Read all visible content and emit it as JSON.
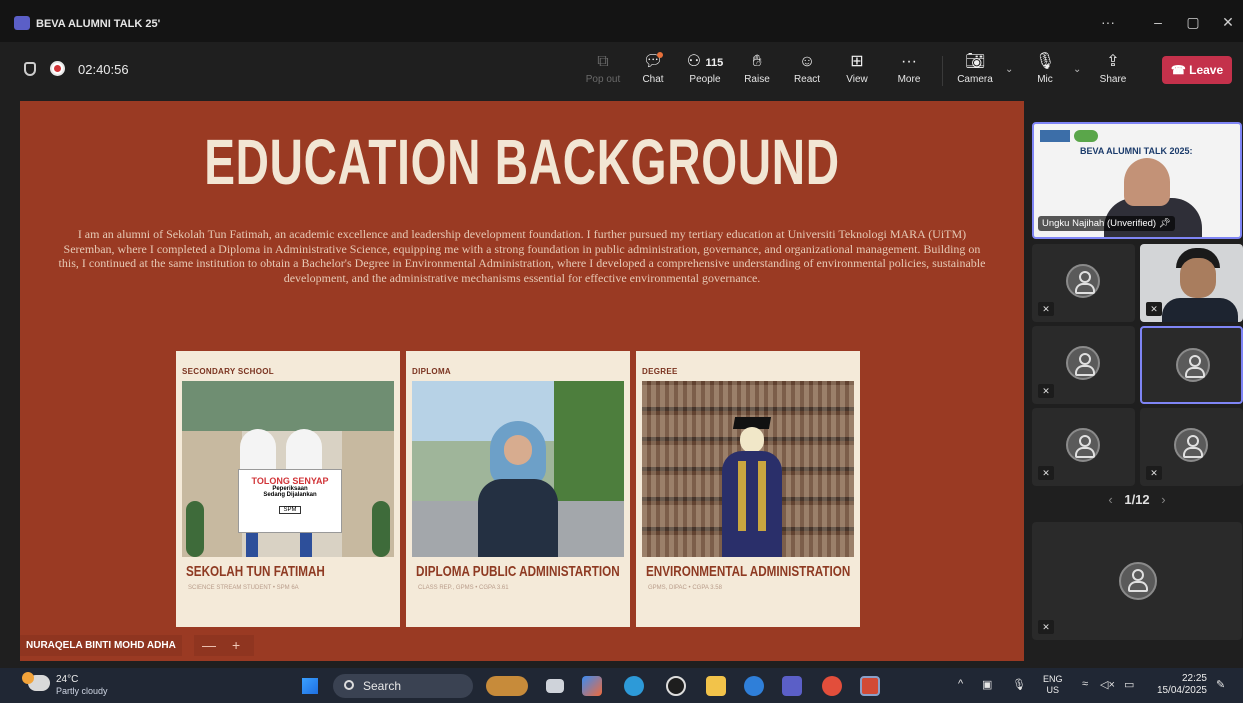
{
  "window": {
    "title": "BEVA ALUMNI TALK 25'",
    "more": "···",
    "minimize": "–",
    "maximize": "▢",
    "close": "✕"
  },
  "meeting": {
    "elapsed": "02:40:56",
    "toolbar": {
      "popout": "Pop out",
      "chat": "Chat",
      "people_count": "115",
      "people": "People",
      "raise": "Raise",
      "react": "React",
      "view": "View",
      "more": "More",
      "camera": "Camera",
      "mic": "Mic",
      "share": "Share",
      "leave": "Leave"
    }
  },
  "slide": {
    "title": "EDUCATION BACKGROUND",
    "body": "I am an alumni of Sekolah Tun Fatimah, an academic excellence and leadership development foundation. I further pursued my tertiary education at Universiti Teknologi MARA (UiTM) Seremban, where I completed a Diploma in Administrative Science, equipping me with a strong foundation in public administration, governance, and organizational management. Building on this, I continued at the same institution to obtain a Bachelor's Degree in Environmental Administration, where I developed a comprehensive understanding of environmental policies, sustainable development, and the administrative mechanisms essential for effective environmental governance.",
    "cards": [
      {
        "tag": "SECONDARY SCHOOL",
        "name": "SEKOLAH TUN FATIMAH",
        "sub": "SCIENCE STREAM STUDENT • SPM 6A",
        "sign1": "TOLONG SENYAP",
        "sign2": "Peperiksaan",
        "sign3": "Sedang Dijalankan",
        "sign4": "SPM"
      },
      {
        "tag": "DIPLOMA",
        "name": "DIPLOMA PUBLIC ADMINISTARTION",
        "sub": "CLASS REP., GPMS • CGPA 3.61"
      },
      {
        "tag": "DEGREE",
        "name": "ENVIRONMENTAL ADMINISTRATION",
        "sub": "GPMS, DIPAC • CGPA 3.58"
      }
    ]
  },
  "presenter_label": "NURAQELA BINTI MOHD ADHA",
  "zoom": {
    "minus": "—",
    "plus": "+"
  },
  "featured": {
    "banner": "BEVA ALUMNI TALK 2025:",
    "name": "Ungku Najihah (Unverified)"
  },
  "pager": {
    "prev": "‹",
    "page": "1/12",
    "next": "›"
  },
  "taskbar": {
    "temp": "24°C",
    "condition": "Partly cloudy",
    "search": "Search",
    "lang_top": "ENG",
    "lang_bottom": "US",
    "time": "22:25",
    "date": "15/04/2025"
  }
}
